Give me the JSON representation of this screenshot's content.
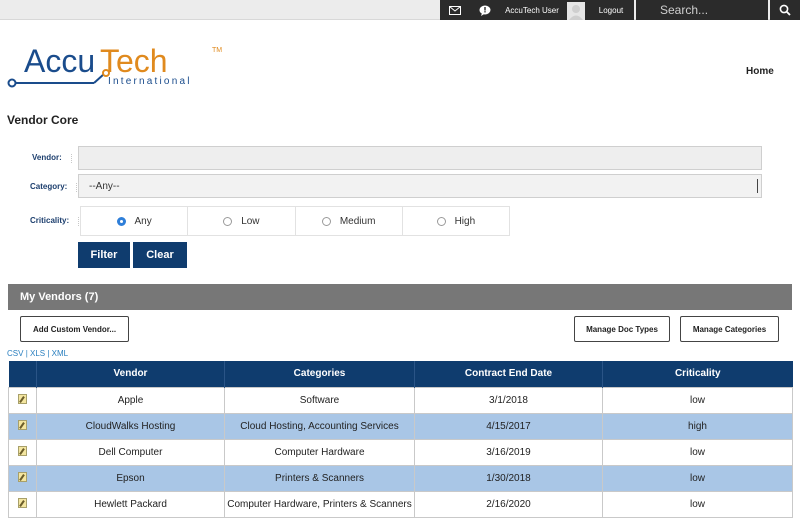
{
  "topbar": {
    "user_label": "AccuTech User",
    "logout_label": "Logout",
    "search_placeholder": "Search..."
  },
  "logo": {
    "name": "AccuTech",
    "tm": "TM",
    "sub": "International"
  },
  "nav": {
    "home_label": "Home"
  },
  "page_title": "Vendor Core",
  "filter": {
    "vendor_label": "Vendor:",
    "vendor_value": "",
    "category_label": "Category:",
    "category_value": "--Any--",
    "criticality_label": "Criticality:",
    "criticality_options": [
      "Any",
      "Low",
      "Medium",
      "High"
    ],
    "criticality_selected": "Any",
    "filter_button": "Filter",
    "clear_button": "Clear"
  },
  "my_vendors": {
    "title": "My Vendors (7)",
    "add_custom_button": "Add Custom Vendor...",
    "manage_doc_types_button": "Manage Doc Types",
    "manage_categories_button": "Manage Categories",
    "exports": [
      "CSV",
      "XLS",
      "XML"
    ],
    "export_separator": "|"
  },
  "table": {
    "columns": [
      "",
      "Vendor",
      "Categories",
      "Contract End Date",
      "Criticality"
    ],
    "rows": [
      {
        "vendor": "Apple",
        "categories": "Software",
        "end_date": "3/1/2018",
        "criticality": "low"
      },
      {
        "vendor": "CloudWalks Hosting",
        "categories": "Cloud Hosting, Accounting Services",
        "end_date": "4/15/2017",
        "criticality": "high"
      },
      {
        "vendor": "Dell Computer",
        "categories": "Computer Hardware",
        "end_date": "3/16/2019",
        "criticality": "low"
      },
      {
        "vendor": "Epson",
        "categories": "Printers & Scanners",
        "end_date": "1/30/2018",
        "criticality": "low"
      },
      {
        "vendor": "Hewlett Packard",
        "categories": "Computer Hardware, Printers & Scanners",
        "end_date": "2/16/2020",
        "criticality": "low"
      }
    ]
  },
  "colors": {
    "brand_navy": "#0f3c6e",
    "row_alt": "#a9c6e6",
    "header_gray": "#777777",
    "logo_blue": "#1a4c8c",
    "logo_orange": "#e08a1e"
  },
  "icons": {
    "mail": "mail-icon",
    "chat": "chat-icon",
    "avatar": "avatar-icon",
    "search": "search-icon",
    "edit": "edit-icon"
  }
}
